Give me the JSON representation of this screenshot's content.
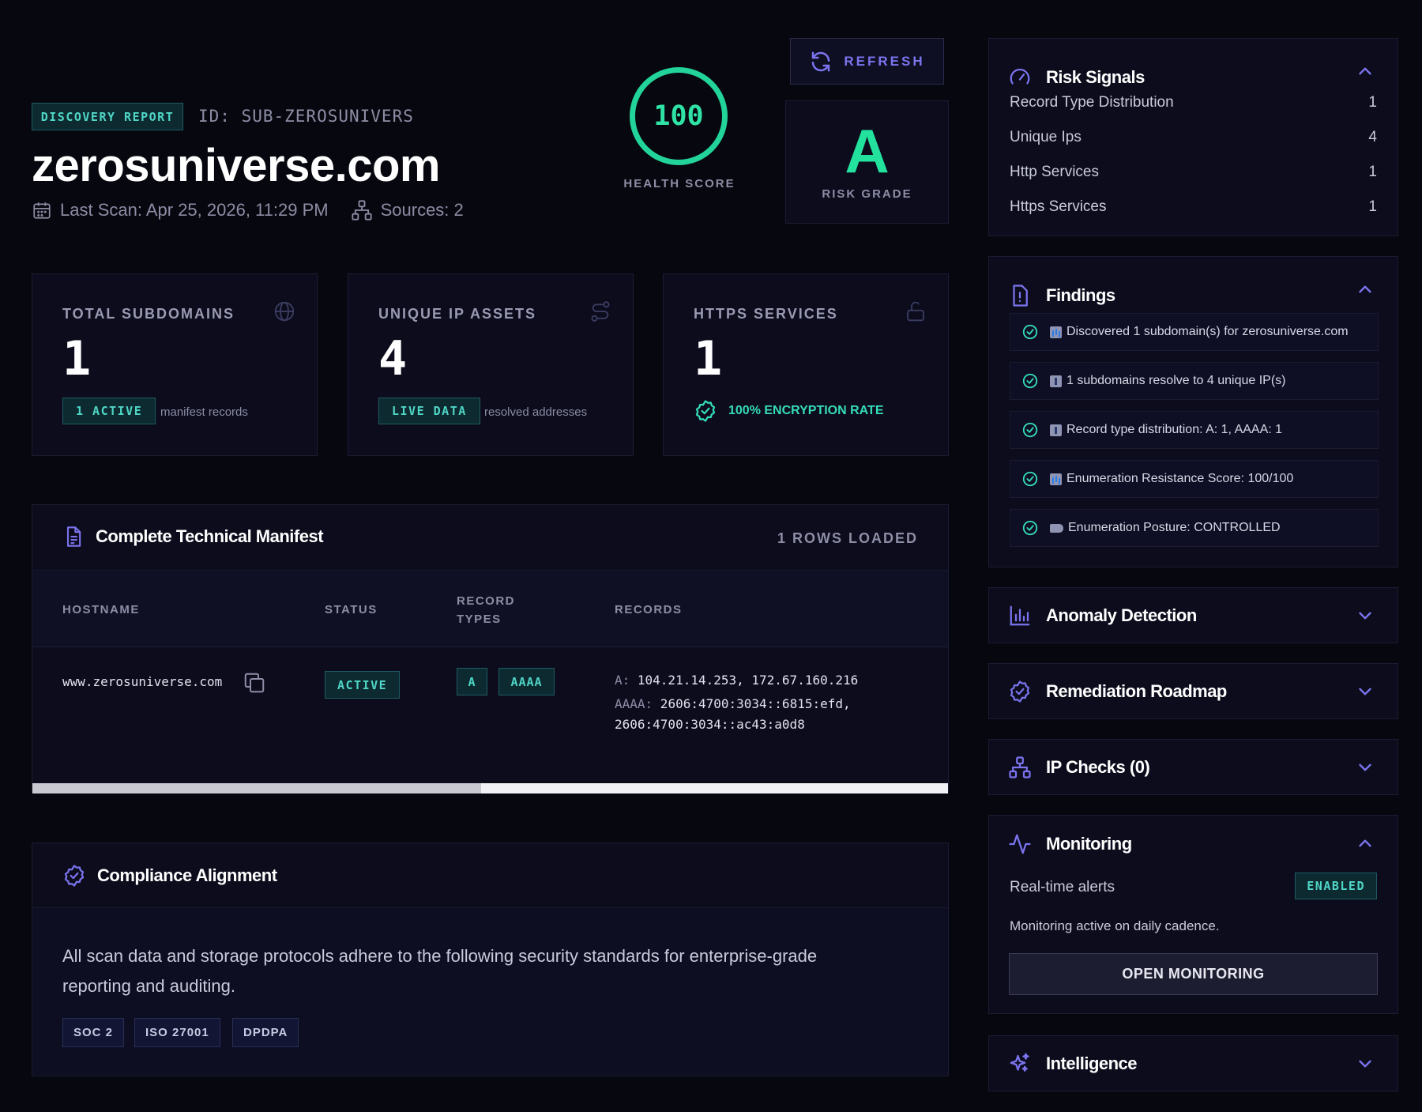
{
  "header": {
    "report_tag": "DISCOVERY REPORT",
    "report_id": "ID: SUB-ZEROSUNIVERS",
    "domain": "zerosuniverse.com",
    "last_scan": "Last Scan: Apr 25, 2026, 11:29 PM",
    "sources": "Sources: 2",
    "health_score": "100",
    "health_label": "HEALTH SCORE",
    "refresh_label": "REFRESH",
    "risk_grade": "A",
    "risk_grade_label": "RISK GRADE"
  },
  "stats": [
    {
      "title": "TOTAL SUBDOMAINS",
      "value": "1",
      "badge": "1 ACTIVE",
      "note": "manifest records",
      "icon": "globe-icon"
    },
    {
      "title": "UNIQUE IP ASSETS",
      "value": "4",
      "badge": "LIVE DATA",
      "note": "resolved addresses",
      "icon": "route-icon"
    },
    {
      "title": "HTTPS SERVICES",
      "value": "1",
      "enc": "100% ENCRYPTION RATE",
      "icon": "lock-open-icon"
    }
  ],
  "manifest": {
    "title": "Complete Technical Manifest",
    "rows_loaded": "1 ROWS LOADED",
    "columns": {
      "hostname": "HOSTNAME",
      "status": "STATUS",
      "record_types_1": "RECORD",
      "record_types_2": "TYPES",
      "records": "RECORDS"
    },
    "rows": [
      {
        "hostname": "www.zerosuniverse.com",
        "status": "ACTIVE",
        "types": [
          "A",
          "AAAA"
        ],
        "a_key": "A:",
        "a_values": " 104.21.14.253, 172.67.160.216",
        "aaaa_key": "AAAA:",
        "aaaa_values_1": " 2606:4700:3034::6815:efd,",
        "aaaa_values_2": "2606:4700:3034::ac43:a0d8"
      }
    ],
    "scroll_fraction": 0.49
  },
  "compliance": {
    "title": "Compliance Alignment",
    "text": "All scan data and storage protocols adhere to the following security standards for enterprise-grade reporting and auditing.",
    "standards": [
      "SOC 2",
      "ISO 27001",
      "DPDPA"
    ]
  },
  "risk_signals": {
    "title": "Risk Signals",
    "items": [
      {
        "label": "Record Type Distribution",
        "value": "1"
      },
      {
        "label": "Unique Ips",
        "value": "4"
      },
      {
        "label": "Http Services",
        "value": "1"
      },
      {
        "label": "Https Services",
        "value": "1"
      }
    ]
  },
  "findings": {
    "title": "Findings",
    "items": [
      {
        "glyph": "bar-chart-icon",
        "text": "Discovered 1 subdomain(s) for zerosuniverse.com"
      },
      {
        "glyph": "info-icon",
        "text": "1 subdomains resolve to 4 unique IP(s)"
      },
      {
        "glyph": "info-icon",
        "text": "Record type distribution: A: 1, AAAA: 1"
      },
      {
        "glyph": "bar-chart-icon",
        "text": "Enumeration Resistance Score: 100/100"
      },
      {
        "glyph": "tag-icon",
        "text": "Enumeration Posture: CONTROLLED"
      }
    ]
  },
  "collapsed_panels": {
    "anomaly": "Anomaly Detection",
    "remediation": "Remediation Roadmap",
    "ipchecks": "IP Checks (0)",
    "intelligence": "Intelligence"
  },
  "monitoring": {
    "title": "Monitoring",
    "alerts_label": "Real-time alerts",
    "alerts_status": "ENABLED",
    "cadence": "Monitoring active on daily cadence.",
    "button": "OPEN MONITORING"
  },
  "colors": {
    "accent": "#7b74ee",
    "success": "#22d39a",
    "teal": "#4fd6c6",
    "background": "#07070f",
    "card": "#0c0c1d"
  }
}
